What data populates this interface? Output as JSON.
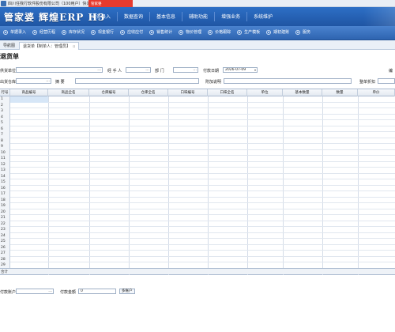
{
  "window": {
    "title": "四川任我行软件股份有限公司（100用户）快消版",
    "badge_text": "管家婆"
  },
  "header": {
    "logo": "管家婆 辉煌ERP H3",
    "nav": [
      "业务录入",
      "数据查询",
      "基本信息",
      "辅助功能",
      "增强业务",
      "系统维护"
    ]
  },
  "toolbar": {
    "items": [
      {
        "label": "单据录入",
        "icon": "document-icon"
      },
      {
        "label": "经营历程",
        "icon": "history-icon"
      },
      {
        "label": "库存状况",
        "icon": "inventory-icon"
      },
      {
        "label": "现金银行",
        "icon": "bank-icon"
      },
      {
        "label": "应收应付",
        "icon": "receivable-icon"
      },
      {
        "label": "销售统计",
        "icon": "sales-stats-icon"
      },
      {
        "label": "物价管理",
        "icon": "price-icon"
      },
      {
        "label": "价格跟踪",
        "icon": "price-track-icon"
      },
      {
        "label": "生产模板",
        "icon": "production-icon"
      },
      {
        "label": "期初建账",
        "icon": "opening-icon"
      },
      {
        "label": "服务",
        "icon": "service-icon"
      }
    ]
  },
  "tabs": [
    {
      "label": "导航图"
    },
    {
      "label": "退货单【制单人：管理员】"
    }
  ],
  "form": {
    "title": "退货单",
    "supplier_label": "供货单位",
    "handler_label": "经 手 人",
    "dept_label": "部    门",
    "pay_date_label": "付款日期",
    "pay_date_value": "2026-07-09",
    "number_label": "编",
    "warehouse_label": "出货仓库",
    "summary_label": "摘    要",
    "note_label": "附加说明",
    "discount_label": "整单折扣",
    "more_button": "..."
  },
  "grid": {
    "columns": [
      "行号",
      "商品编号",
      "商品全名",
      "仓库编号",
      "仓库全名",
      "口味编号",
      "口味全名",
      "单位",
      "基本数量",
      "数量",
      "单价"
    ],
    "rows": [
      "1",
      "2",
      "3",
      "4",
      "5",
      "6",
      "7",
      "8",
      "9",
      "10",
      "11",
      "12",
      "13",
      "14",
      "15",
      "16",
      "17",
      "18",
      "19",
      "20",
      "21",
      "22",
      "23",
      "24",
      "25",
      "26",
      "27",
      "28",
      "29"
    ],
    "sum_label": "合计"
  },
  "footer": {
    "pay_account_label": "付款账户",
    "pay_amount_label": "付款金额",
    "pay_amount_value": "0",
    "multi_account_button": "多账户"
  }
}
